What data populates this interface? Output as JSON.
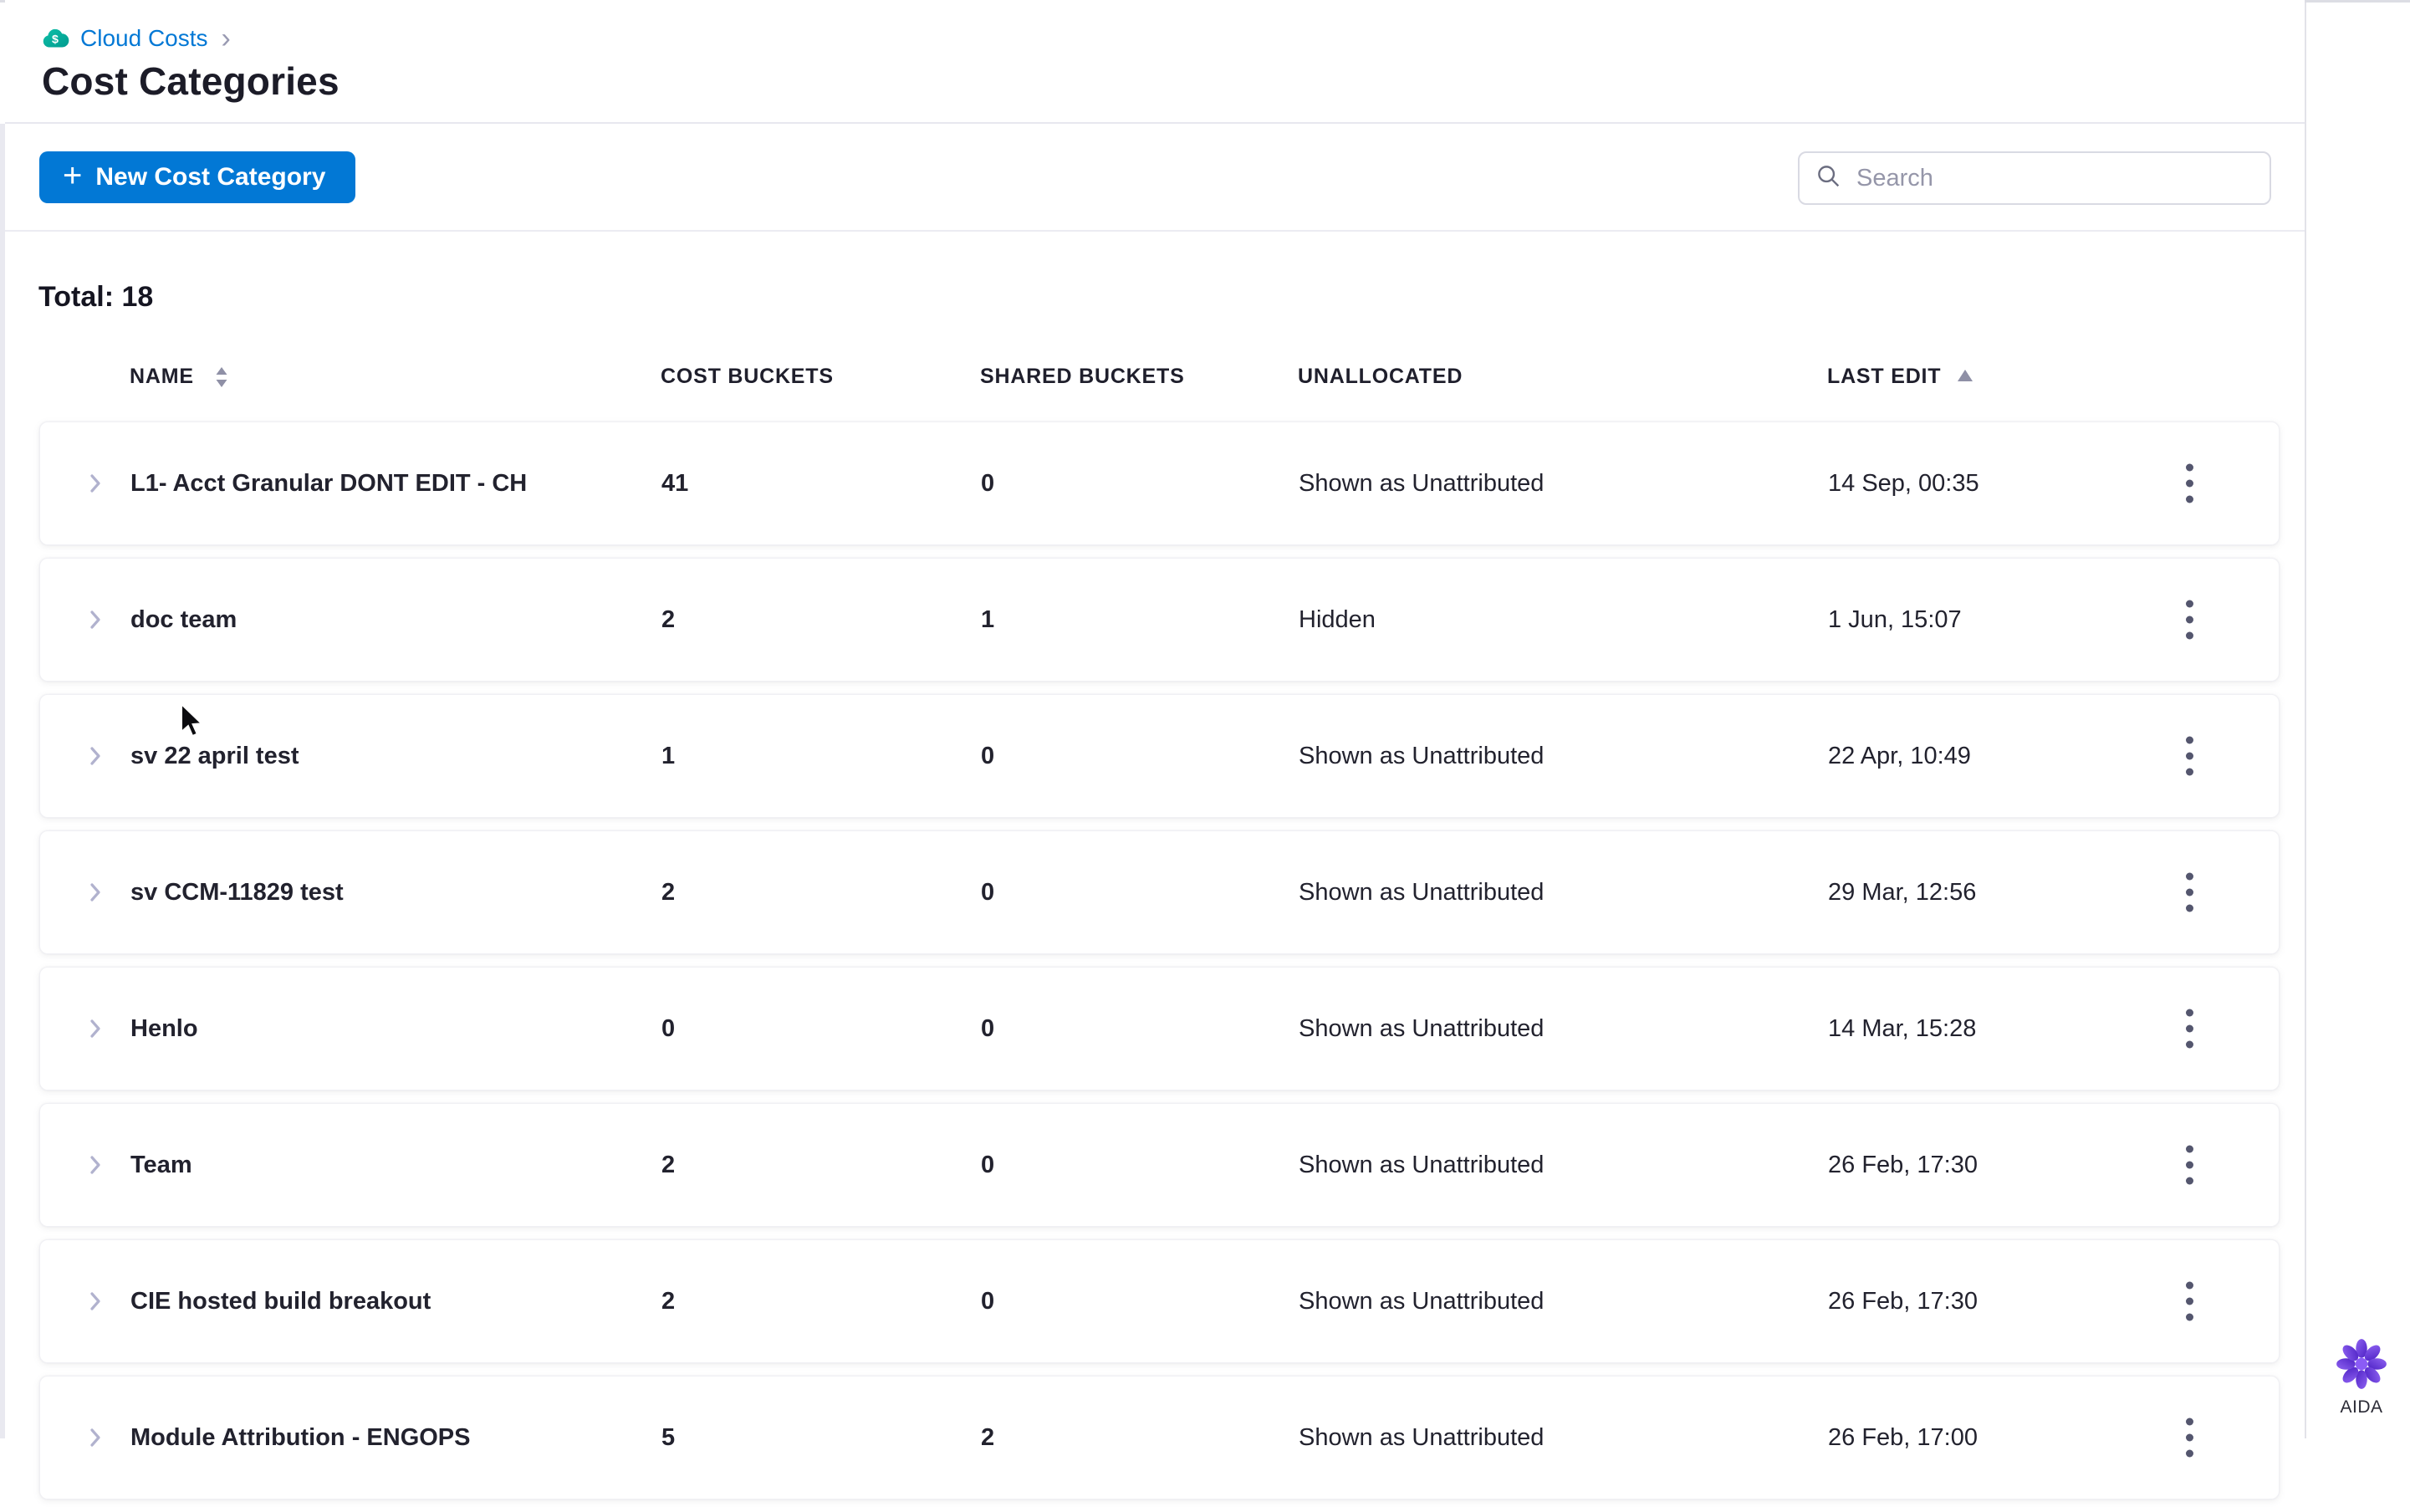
{
  "breadcrumb": {
    "item": "Cloud Costs",
    "separator": "›"
  },
  "page": {
    "title": "Cost Categories",
    "total_label": "Total:",
    "total_value": "18"
  },
  "toolbar": {
    "plus": "+",
    "new_button": "New Cost Category",
    "search_placeholder": "Search"
  },
  "table": {
    "columns": [
      "NAME",
      "COST BUCKETS",
      "SHARED BUCKETS",
      "UNALLOCATED",
      "LAST EDIT"
    ],
    "sort": {
      "name_sortable": true,
      "last_edit_direction": "ascending"
    },
    "rows": [
      {
        "name": "L1- Acct Granular DONT EDIT - CH",
        "cost_buckets": "41",
        "shared_buckets": "0",
        "unallocated": "Shown as Unattributed",
        "last_edit": "14 Sep, 00:35"
      },
      {
        "name": "doc team",
        "cost_buckets": "2",
        "shared_buckets": "1",
        "unallocated": "Hidden",
        "last_edit": "1 Jun, 15:07"
      },
      {
        "name": "sv 22 april test",
        "cost_buckets": "1",
        "shared_buckets": "0",
        "unallocated": "Shown as Unattributed",
        "last_edit": "22 Apr, 10:49"
      },
      {
        "name": "sv CCM-11829 test",
        "cost_buckets": "2",
        "shared_buckets": "0",
        "unallocated": "Shown as Unattributed",
        "last_edit": "29 Mar, 12:56"
      },
      {
        "name": "Henlo",
        "cost_buckets": "0",
        "shared_buckets": "0",
        "unallocated": "Shown as Unattributed",
        "last_edit": "14 Mar, 15:28"
      },
      {
        "name": "Team",
        "cost_buckets": "2",
        "shared_buckets": "0",
        "unallocated": "Shown as Unattributed",
        "last_edit": "26 Feb, 17:30"
      },
      {
        "name": "CIE hosted build breakout",
        "cost_buckets": "2",
        "shared_buckets": "0",
        "unallocated": "Shown as Unattributed",
        "last_edit": "26 Feb, 17:30"
      },
      {
        "name": "Module Attribution - ENGOPS",
        "cost_buckets": "5",
        "shared_buckets": "2",
        "unallocated": "Shown as Unattributed",
        "last_edit": "26 Feb, 17:00"
      }
    ]
  },
  "aida": {
    "label": "AIDA"
  },
  "colors": {
    "accent_blue": "#0278d5",
    "icon_teal": "#06b7a0",
    "aida_purple": "#6a3bd8",
    "text": "#1c1c28"
  }
}
